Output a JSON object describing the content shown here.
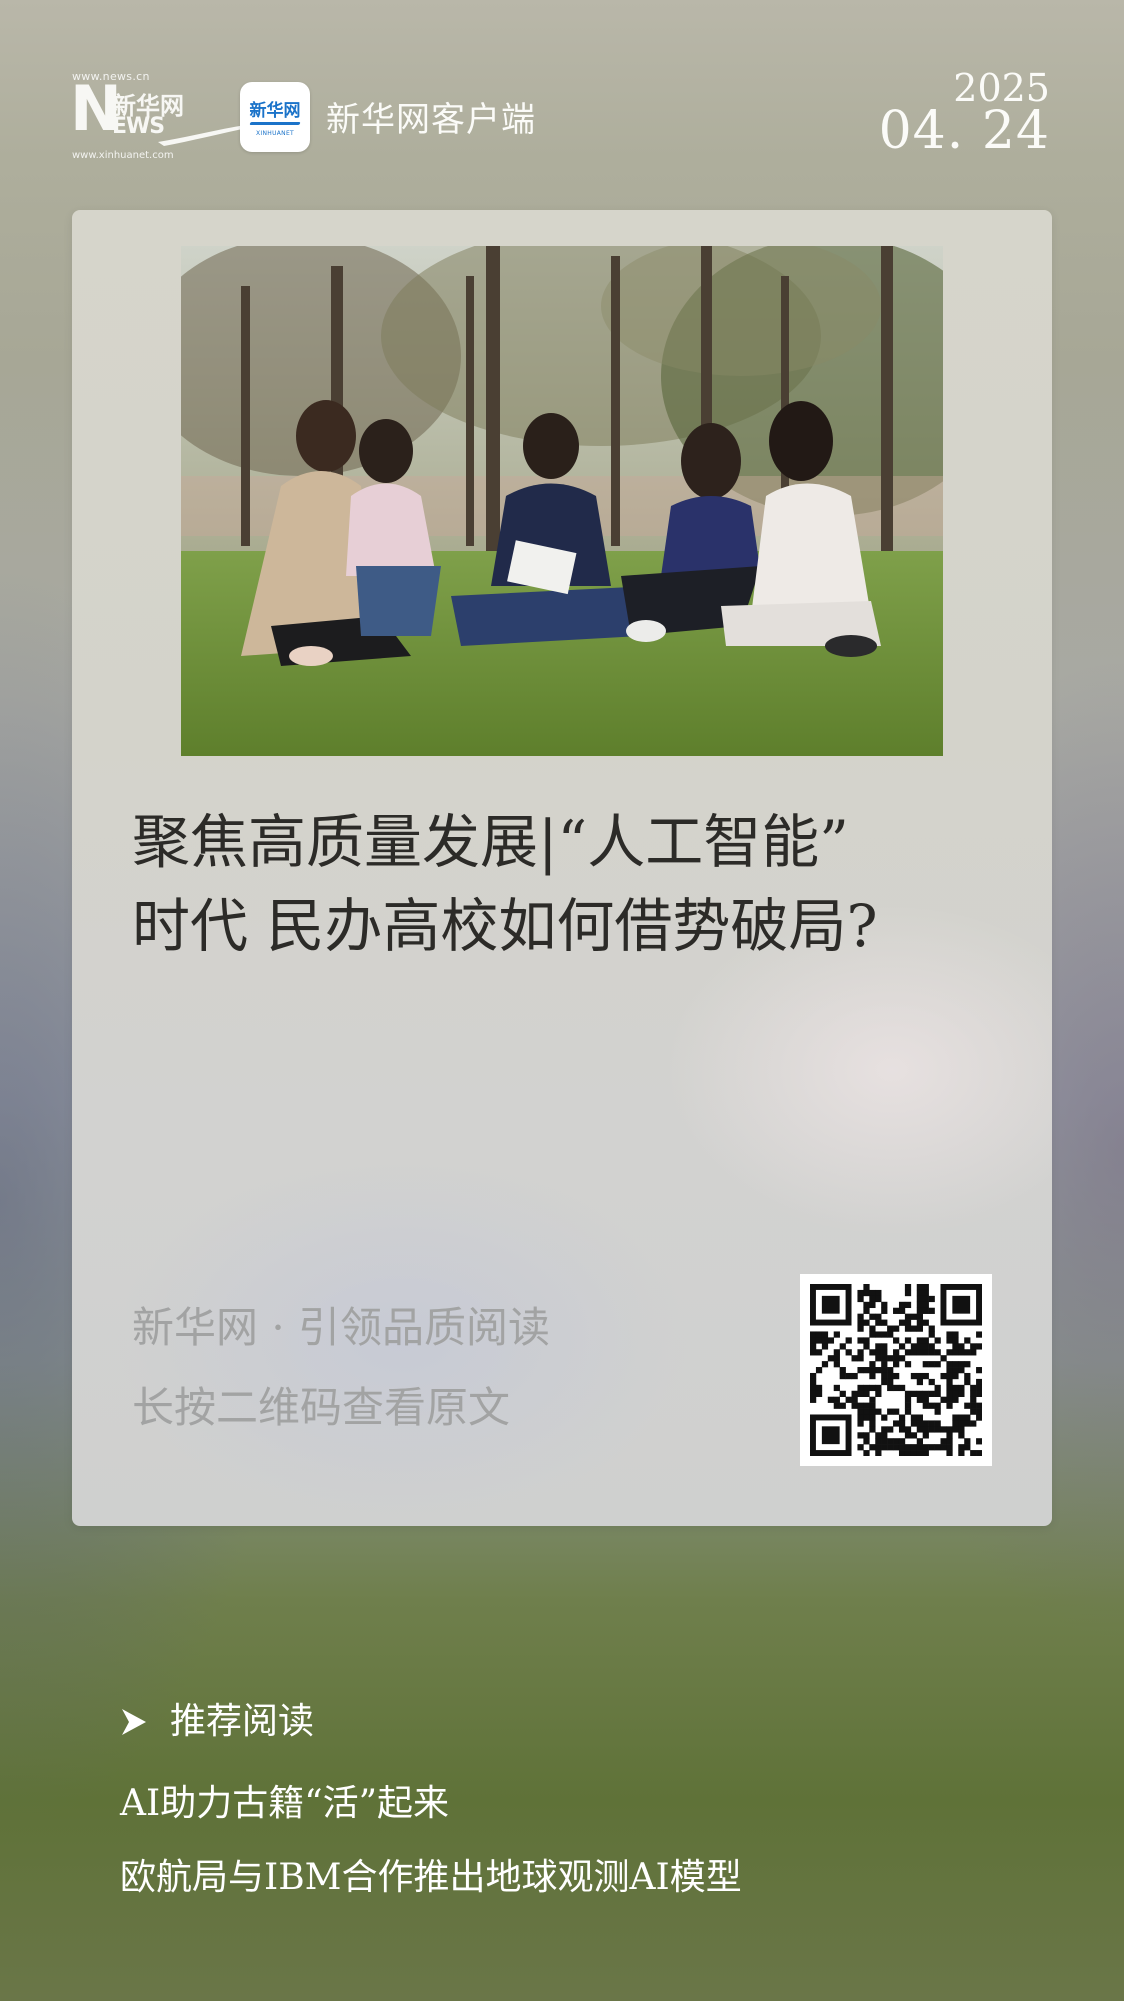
{
  "header": {
    "logo": {
      "url_top": "www.news.cn",
      "letter": "N",
      "cn": "新华网",
      "en": "EWS",
      "url_bottom": "www.xinhuanet.com"
    },
    "app_icon": {
      "cn": "新华网",
      "en": "XINHUANET"
    },
    "app_name": "新华网客户端",
    "date": {
      "year": "2025",
      "day": "04. 24"
    }
  },
  "card": {
    "headline_lines": [
      "聚焦高质量发展|“人工智能”",
      "时代  民办高校如何借势破局?"
    ],
    "slogan": "新华网 · 引领品质阅读",
    "qr_hint": "长按二维码查看原文"
  },
  "recommended": {
    "title": "推荐阅读",
    "items": [
      "AI助力古籍“活”起来",
      "欧航局与IBM合作推出地球观测AI模型"
    ]
  },
  "colors": {
    "headline": "#2c2b28",
    "muted_text": "#a2a3a3",
    "white_text": "#ffffff",
    "app_icon_blue": "#1b73c9"
  }
}
